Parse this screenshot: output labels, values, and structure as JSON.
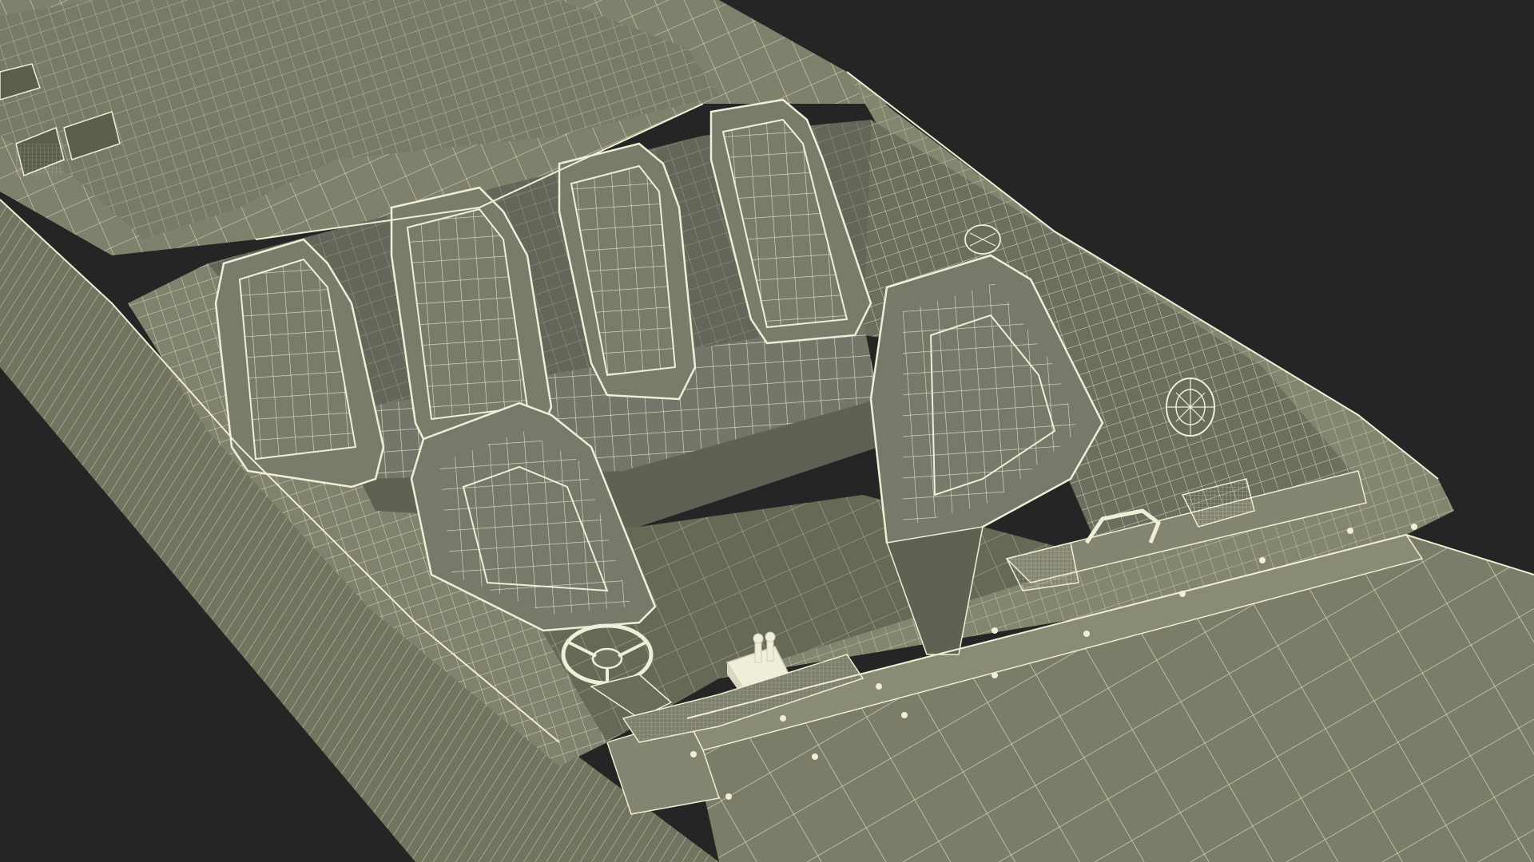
{
  "scene": {
    "subject": "speedboat-wireframe",
    "colors": {
      "background": "#252525",
      "hull_surface": "#7d7f6c",
      "hull_shadow": "#5d5f4f",
      "cockpit_floor": "#676957",
      "seat_fill": "#74766a",
      "wire": "#f1efd8"
    },
    "icons": [
      "steering-wheel-icon",
      "throttle-lever-icon",
      "speaker-icon",
      "grab-handle-icon"
    ]
  }
}
